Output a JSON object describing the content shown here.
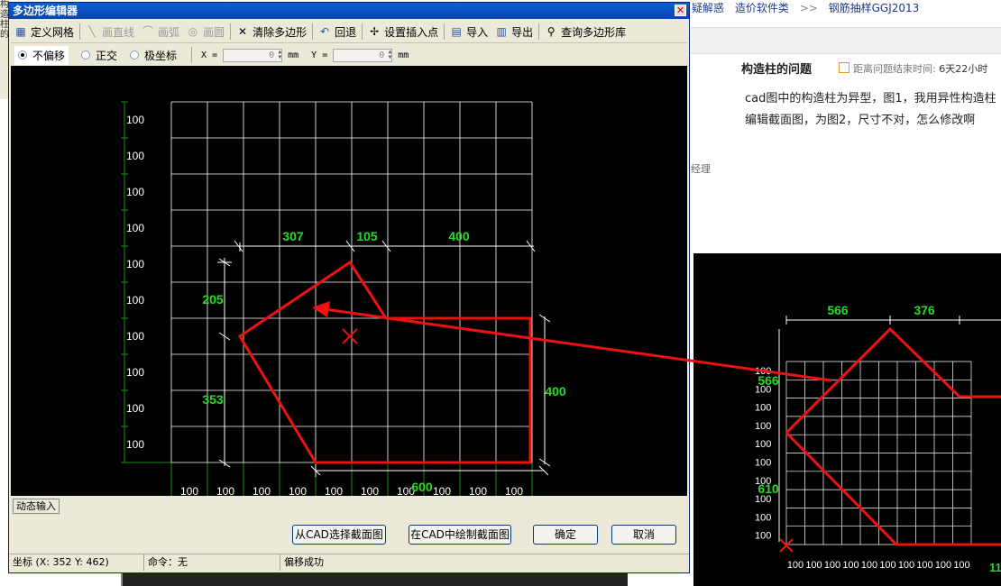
{
  "background": {
    "left_strip": [
      "构",
      "造",
      "柱",
      "的"
    ],
    "breadcrumb": [
      "疑解惑",
      "造价软件类",
      ">>",
      "钢筋抽样GGJ2013"
    ],
    "question_title": "构造柱的问题",
    "question_meta_label": "距离问题结束时间:",
    "question_meta_value": "6天22小时",
    "question_body": "cad图中的构造柱为异型，图1，我用异性构造柱编辑截面图，为图2，尺寸不对，怎么修改啊",
    "side_text": "经理",
    "cad2": {
      "top_dims": [
        "566",
        "376"
      ],
      "left_dims": [
        "566",
        "610"
      ],
      "row_labels": [
        "100",
        "100",
        "100",
        "100",
        "100",
        "100",
        "100",
        "100",
        "100",
        "100"
      ],
      "col_labels": [
        "100",
        "100",
        "100",
        "100",
        "100",
        "100",
        "100",
        "100",
        "100",
        "100"
      ],
      "right_clip": "11"
    }
  },
  "dialog": {
    "title": "多边形编辑器",
    "toolbar": [
      {
        "name": "define-grid",
        "icon": "grid-icon",
        "label": "定义网格",
        "enabled": true
      },
      {
        "name": "draw-line",
        "icon": "line-icon",
        "label": "画直线",
        "enabled": false
      },
      {
        "name": "draw-arc",
        "icon": "arc-icon",
        "label": "画弧",
        "enabled": false
      },
      {
        "name": "draw-circle",
        "icon": "circle-icon",
        "label": "画圆",
        "enabled": false
      },
      {
        "name": "clear-polygon",
        "icon": "x-icon",
        "label": "清除多边形",
        "enabled": true
      },
      {
        "name": "undo",
        "icon": "undo-icon",
        "label": "回退",
        "enabled": true
      },
      {
        "name": "set-insert-point",
        "icon": "insert-point-icon",
        "label": "设置插入点",
        "enabled": true
      },
      {
        "name": "import",
        "icon": "import-icon",
        "label": "导入",
        "enabled": true
      },
      {
        "name": "export",
        "icon": "export-icon",
        "label": "导出",
        "enabled": true
      },
      {
        "name": "query-library",
        "icon": "magnifier-icon",
        "label": "查询多边形库",
        "enabled": true
      }
    ],
    "options": {
      "radios": [
        {
          "label": "不偏移",
          "checked": true
        },
        {
          "label": "正交",
          "checked": false
        },
        {
          "label": "极坐标",
          "checked": false
        }
      ],
      "x_label": "X =",
      "x_value": "0",
      "y_label": "Y =",
      "y_value": "0",
      "unit": "mm"
    },
    "canvas": {
      "row_labels": [
        "100",
        "100",
        "100",
        "100",
        "100",
        "100",
        "100",
        "100",
        "100",
        "100"
      ],
      "col_labels": [
        "100",
        "100",
        "100",
        "100",
        "100",
        "100",
        "100",
        "100",
        "100",
        "100"
      ],
      "top_dims": [
        "307",
        "105",
        "400"
      ],
      "left_dims": [
        "205",
        "353"
      ],
      "right_dim": "400",
      "bottom_dim": "600"
    },
    "dynamic_input_label": "动态输入",
    "buttons": {
      "select_from_cad": "从CAD选择截面图",
      "draw_in_cad": "在CAD中绘制截面图",
      "ok": "确定",
      "cancel": "取消"
    },
    "status": {
      "coords": "坐标 (X: 352 Y: 462)",
      "command": "命令：无",
      "message": "偏移成功"
    }
  },
  "colors": {
    "dim_text": "#22dd22",
    "polygon": "#ee1111",
    "grid": "#ffffff",
    "axis_green": "#1a8a1a",
    "titlebar": "#0a5fd8"
  }
}
